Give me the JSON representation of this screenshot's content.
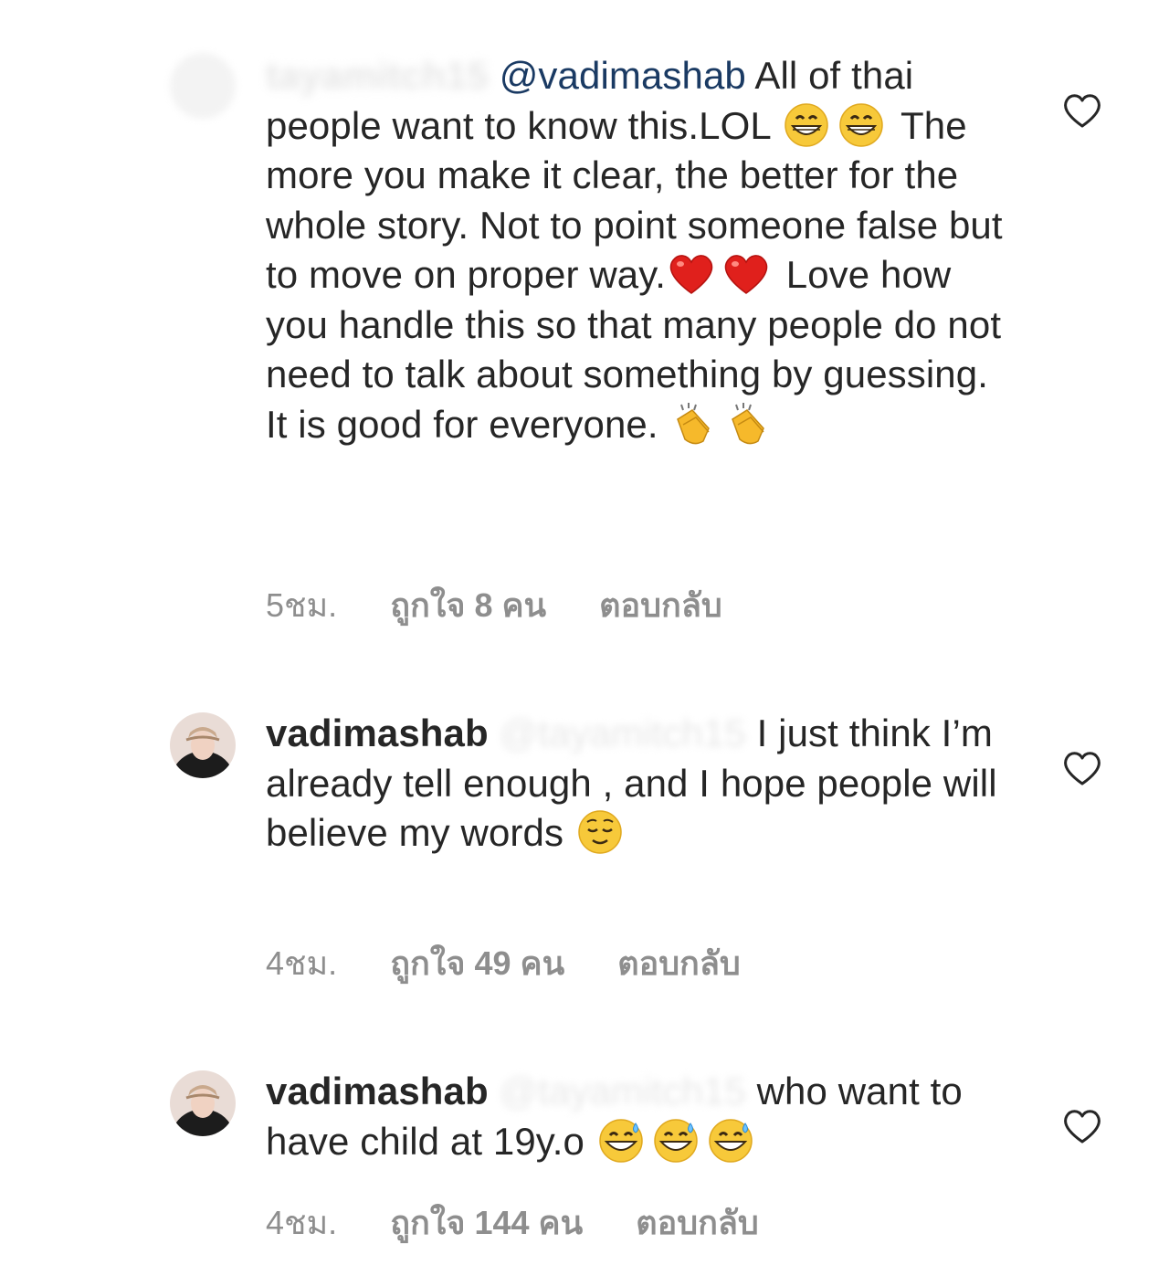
{
  "comments": [
    {
      "username": "tayamitch15",
      "username_blurred": true,
      "mention": "@vadimashab",
      "segments": [
        {
          "type": "text",
          "value": " All of thai people want to know this.LOL "
        },
        {
          "type": "emoji",
          "value": "grinning-face-icon"
        },
        {
          "type": "emoji",
          "value": "grinning-face-icon"
        },
        {
          "type": "text",
          "value": " The more you make it clear, the better for the whole story.  Not to point someone false but to move on proper way."
        },
        {
          "type": "emoji",
          "value": "red-heart-icon"
        },
        {
          "type": "emoji",
          "value": "red-heart-icon"
        },
        {
          "type": "text",
          "value": " Love how you handle this so that many people do not need to talk about something by guessing. It is good for everyone. "
        },
        {
          "type": "emoji",
          "value": "clapping-hands-icon"
        },
        {
          "type": "emoji",
          "value": "clapping-hands-icon"
        }
      ],
      "time": "5ชม.",
      "likes": "ถูกใจ 8 คน",
      "reply": "ตอบกลับ"
    },
    {
      "username": "vadimashab",
      "username_blurred": false,
      "mention": "@tayamitch15",
      "segments": [
        {
          "type": "text",
          "value": " I just think I’m already tell enough , and I hope people will believe my words "
        },
        {
          "type": "emoji",
          "value": "relieved-face-icon"
        }
      ],
      "time": "4ชม.",
      "likes": "ถูกใจ 49 คน",
      "reply": "ตอบกลับ"
    },
    {
      "username": "vadimashab",
      "username_blurred": false,
      "mention": "@tayamitch15",
      "segments": [
        {
          "type": "text",
          "value": " who want to have child at 19y.o "
        },
        {
          "type": "emoji",
          "value": "grinning-sweat-face-icon"
        },
        {
          "type": "emoji",
          "value": "grinning-sweat-face-icon"
        },
        {
          "type": "emoji",
          "value": "grinning-sweat-face-icon"
        }
      ],
      "time": "4ชม.",
      "likes": "ถูกใจ 144 คน",
      "reply": "ตอบกลับ"
    }
  ],
  "colors": {
    "text": "#262626",
    "meta": "#8e8e8e",
    "mention_link": "#1a3a63"
  }
}
